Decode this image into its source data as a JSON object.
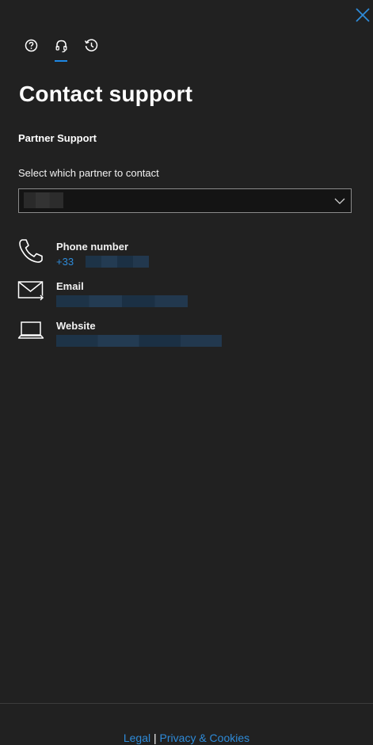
{
  "header": {
    "close_icon": "close-icon",
    "tabs": [
      {
        "icon": "help-icon",
        "active": false
      },
      {
        "icon": "headset-icon",
        "active": true
      },
      {
        "icon": "history-icon",
        "active": false
      }
    ]
  },
  "main": {
    "title": "Contact support",
    "section_heading": "Partner Support",
    "select_label": "Select which partner to contact",
    "contacts": {
      "phone": {
        "icon": "phone-icon",
        "label": "Phone number",
        "prefix": "+33"
      },
      "email": {
        "icon": "email-icon",
        "label": "Email"
      },
      "website": {
        "icon": "laptop-icon",
        "label": "Website"
      }
    }
  },
  "footer": {
    "legal": "Legal",
    "separator": "|",
    "privacy": "Privacy & Cookies"
  },
  "colors": {
    "background": "#212121",
    "accent": "#2e8bd9",
    "text": "#ffffff"
  }
}
